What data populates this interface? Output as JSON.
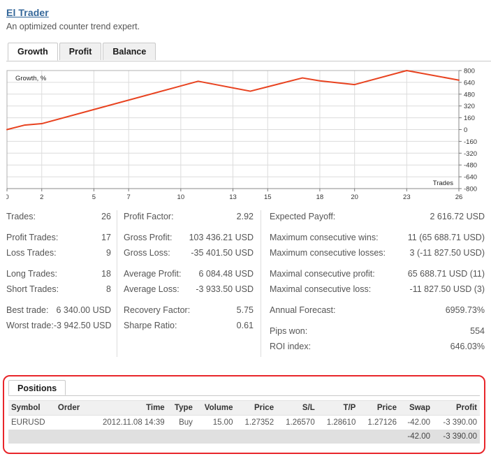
{
  "header": {
    "title": "El Trader",
    "subtitle": "An optimized counter trend expert."
  },
  "tabs": [
    {
      "label": "Growth",
      "active": true
    },
    {
      "label": "Profit",
      "active": false
    },
    {
      "label": "Balance",
      "active": false
    }
  ],
  "chart_data": {
    "type": "line",
    "title": "",
    "annotation_y": "Growth, %",
    "annotation_x": "Trades",
    "xlabel": "Trades",
    "ylabel": "Growth, %",
    "xlim": [
      0,
      26
    ],
    "ylim": [
      -800,
      800
    ],
    "yticks": [
      800,
      640,
      480,
      320,
      160,
      0,
      -160,
      -320,
      -480,
      -640,
      -800
    ],
    "xticks": [
      0,
      2,
      5,
      7,
      10,
      13,
      15,
      18,
      20,
      23,
      26
    ],
    "grid": true,
    "legend": "none",
    "line_color": "#e8421f",
    "series": [
      {
        "name": "Growth, %",
        "x": [
          0,
          1,
          2,
          11,
          12,
          14,
          17,
          18,
          20,
          23,
          26
        ],
        "values": [
          0,
          60,
          80,
          655,
          610,
          520,
          700,
          660,
          610,
          800,
          670
        ]
      }
    ]
  },
  "stats": {
    "col1": [
      {
        "label": "Trades:",
        "value": "26",
        "gap": false
      },
      {
        "label": "Profit Trades:",
        "value": "17",
        "gap": true
      },
      {
        "label": "Loss Trades:",
        "value": "9",
        "gap": false
      },
      {
        "label": "Long Trades:",
        "value": "18",
        "gap": true
      },
      {
        "label": "Short Trades:",
        "value": "8",
        "gap": false
      },
      {
        "label": "Best trade:",
        "value": "6 340.00 USD",
        "gap": true
      },
      {
        "label": "Worst trade:",
        "value": "-3 942.50 USD",
        "gap": false
      }
    ],
    "col2": [
      {
        "label": "Profit Factor:",
        "value": "2.92",
        "gap": false
      },
      {
        "label": "Gross Profit:",
        "value": "103 436.21 USD",
        "gap": true
      },
      {
        "label": "Gross Loss:",
        "value": "-35 401.50 USD",
        "gap": false
      },
      {
        "label": "Average Profit:",
        "value": "6 084.48 USD",
        "gap": true
      },
      {
        "label": "Average Loss:",
        "value": "-3 933.50 USD",
        "gap": false
      },
      {
        "label": "Recovery Factor:",
        "value": "5.75",
        "gap": true
      },
      {
        "label": "Sharpe Ratio:",
        "value": "0.61",
        "gap": false
      }
    ],
    "col3": [
      {
        "label": "Expected Payoff:",
        "value": "2 616.72 USD",
        "gap": false
      },
      {
        "label": "Maximum consecutive wins:",
        "value": "11 (65 688.71 USD)",
        "gap": true
      },
      {
        "label": "Maximum consecutive losses:",
        "value": "3 (-11 827.50 USD)",
        "gap": false
      },
      {
        "label": "Maximal consecutive profit:",
        "value": "65 688.71 USD (11)",
        "gap": true
      },
      {
        "label": "Maximal consecutive loss:",
        "value": "-11 827.50 USD (3)",
        "gap": false
      },
      {
        "label": "Annual Forecast:",
        "value": "6959.73%",
        "gap": true
      },
      {
        "label": "Pips won:",
        "value": "554",
        "gap": true
      },
      {
        "label": "ROI index:",
        "value": "646.03%",
        "gap": false
      }
    ]
  },
  "positions": {
    "tab_label": "Positions",
    "highlight_color": "#e8262b",
    "columns": [
      {
        "label": "Symbol",
        "align": "left"
      },
      {
        "label": "Order",
        "align": "left"
      },
      {
        "label": "Time",
        "align": "right"
      },
      {
        "label": "Type",
        "align": "right"
      },
      {
        "label": "Volume",
        "align": "right"
      },
      {
        "label": "Price",
        "align": "right"
      },
      {
        "label": "S/L",
        "align": "right"
      },
      {
        "label": "T/P",
        "align": "right"
      },
      {
        "label": "Price",
        "align": "right"
      },
      {
        "label": "Swap",
        "align": "right"
      },
      {
        "label": "Profit",
        "align": "right"
      }
    ],
    "rows": [
      {
        "symbol": "EURUSD",
        "order": "",
        "time": "2012.11.08 14:39",
        "type": "Buy",
        "volume": "15.00",
        "price": "1.27352",
        "sl": "1.26570",
        "tp": "1.28610",
        "price2": "1.27126",
        "swap": "-42.00",
        "profit": "-3 390.00"
      }
    ],
    "total": {
      "swap": "-42.00",
      "profit": "-3 390.00"
    }
  }
}
